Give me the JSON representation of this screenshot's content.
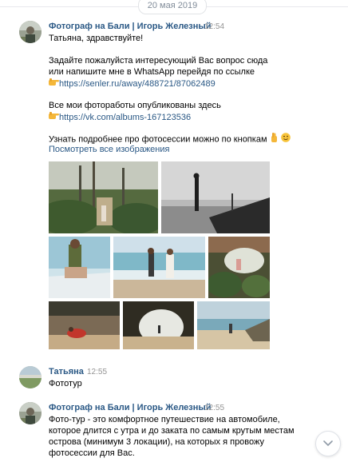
{
  "date_separator": "20 мая 2019",
  "messages": [
    {
      "sender": "Фотограф на Бали | Игорь Железный",
      "time": "12:54",
      "lines": [
        "Татьяна, здравствуйте!",
        "Задайте пожалуйста интересующий Вас вопрос сюда",
        "или напишите мне в WhatsApp перейдя по ссылке",
        "https://senler.ru/away/488721/87062489",
        "Все мои фотоработы опубликованы здесь",
        "https://vk.com/albums-167123536",
        "Узнать подробнее про фотосессии можно по кнопкам"
      ],
      "see_more_link": "Посмотреть все изображения"
    },
    {
      "sender": "Татьяна",
      "time": "12:55",
      "lines": [
        "Фототур"
      ]
    },
    {
      "sender": "Фотограф на Бали | Игорь Железный",
      "time": "12:55",
      "lines": [
        "Фото-тур - это комфортное путешествие на автомобиле,",
        "которое длится с утра и до заката по самым крутым местам",
        "острова (минимум 3 локации), на которых я провожу",
        "фотосессии для Вас."
      ]
    }
  ],
  "icons": {
    "pointing_hand": "backhand-index-pointing-right-icon",
    "fingers_crossed": "fingers-crossed-icon",
    "wink": "winking-face-icon",
    "scroll_down": "chevron-down-icon"
  },
  "colors": {
    "link": "#2a5885",
    "time": "#939393",
    "date_text": "#818c99"
  }
}
